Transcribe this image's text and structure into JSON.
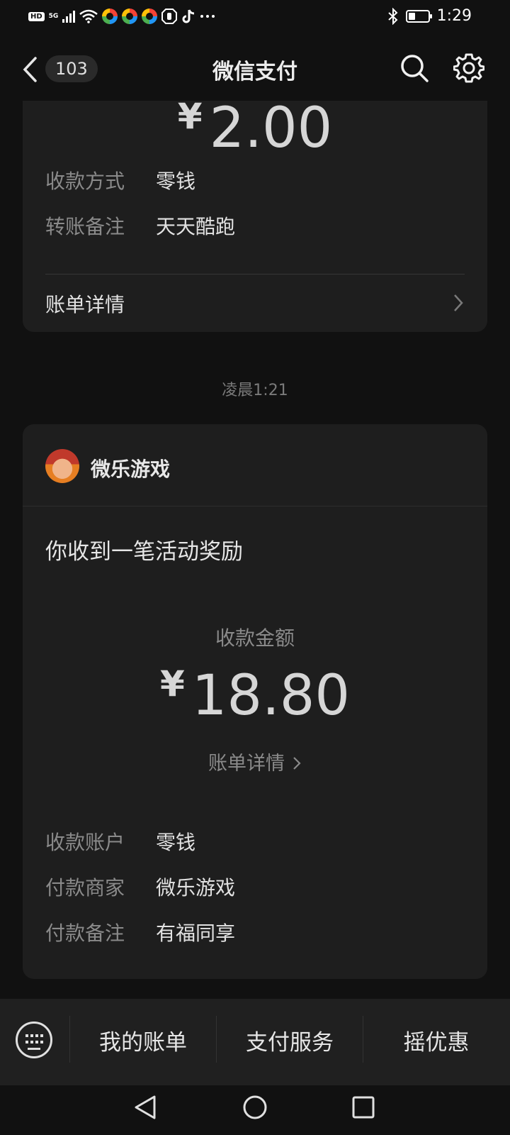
{
  "status_bar": {
    "hd": "HD",
    "network": "5G",
    "time": "1:29",
    "icons": [
      "wifi-icon",
      "app-ring-icon",
      "app-ring-icon",
      "app-ring-icon",
      "hand-icon",
      "tiktok-icon",
      "more-dots-icon",
      "bluetooth-icon",
      "battery-icon"
    ]
  },
  "header": {
    "back_count": "103",
    "title": "微信支付"
  },
  "card1": {
    "currency": "¥",
    "amount": "2.00",
    "rows": [
      {
        "label": "收款方式",
        "value": "零钱"
      },
      {
        "label": "转账备注",
        "value": "天天酷跑"
      }
    ],
    "bill_detail": "账单详情"
  },
  "timestamp": "凌晨1:21",
  "card2": {
    "merchant_name": "微乐游戏",
    "notice": "你收到一笔活动奖励",
    "amount_label": "收款金额",
    "currency": "¥",
    "amount": "18.80",
    "bill_detail": "账单详情",
    "rows": [
      {
        "label": "收款账户",
        "value": "零钱"
      },
      {
        "label": "付款商家",
        "value": "微乐游戏"
      },
      {
        "label": "付款备注",
        "value": "有福同享"
      }
    ]
  },
  "bottom_tabs": [
    {
      "label": "我的账单"
    },
    {
      "label": "支付服务"
    },
    {
      "label": "摇优惠"
    }
  ],
  "colors": {
    "background": "#111111",
    "card": "#1e1e1e",
    "secondary_text": "#8a8a8a"
  }
}
